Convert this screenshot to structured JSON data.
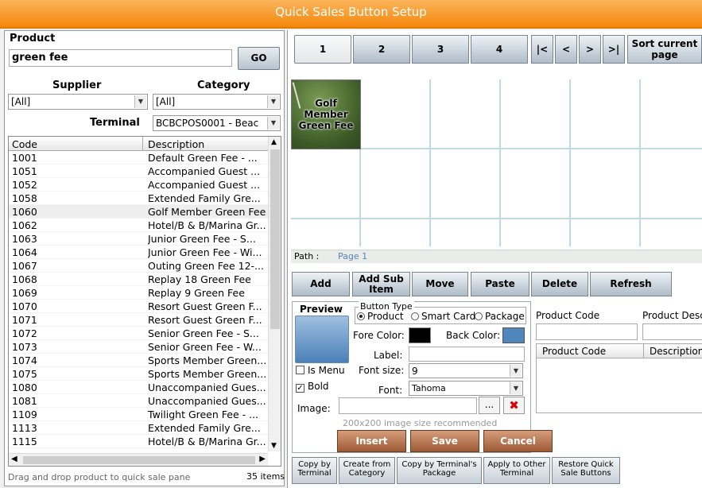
{
  "window": {
    "title": "Quick Sales Button Setup"
  },
  "left": {
    "product_label": "Product",
    "product_value": "green fee",
    "go_label": "GO",
    "supplier_label": "Supplier",
    "category_label": "Category",
    "supplier_value": "[All]",
    "category_value": "[All]",
    "terminal_label": "Terminal",
    "terminal_value": "BCBCPOS0001 - Beac",
    "columns": [
      "Code",
      "Description"
    ],
    "rows": [
      [
        "1001",
        "Default Green Fee - ..."
      ],
      [
        "1051",
        "Accompanied Guest ..."
      ],
      [
        "1052",
        "Accompanied Guest ..."
      ],
      [
        "1058",
        "Extended Family  Gre..."
      ],
      [
        "1060",
        "Golf Member Green Fee"
      ],
      [
        "1062",
        "Hotel/B & B/Marina Gr..."
      ],
      [
        "1063",
        "Junior Green Fee - S..."
      ],
      [
        "1064",
        "Junior Green Fee - Wi..."
      ],
      [
        "1067",
        "Outing Green Fee 12-..."
      ],
      [
        "1068",
        "Replay 18 Green Fee"
      ],
      [
        "1069",
        "Replay 9 Green Fee"
      ],
      [
        "1070",
        "Resort Guest Green F..."
      ],
      [
        "1071",
        "Resort Guest Green F..."
      ],
      [
        "1072",
        "Senior Green Fee - S..."
      ],
      [
        "1073",
        "Senior Green Fee - W..."
      ],
      [
        "1074",
        "Sports Member Green..."
      ],
      [
        "1075",
        "Sports Member Green..."
      ],
      [
        "1080",
        "Unaccompanied Gues..."
      ],
      [
        "1081",
        "Unaccompanied Gues..."
      ],
      [
        "1109",
        "Twilight Green Fee - ..."
      ],
      [
        "1113",
        "Extended Family  Gre..."
      ],
      [
        "1115",
        "Hotel/B & B/Marina Gr..."
      ]
    ],
    "footer_hint": "Drag and drop product to quick sale pane",
    "footer_count": "35 items"
  },
  "pages": {
    "tabs": [
      "1",
      "2",
      "3",
      "4"
    ],
    "first": "|<",
    "prev": "<",
    "next": ">",
    "last": ">|",
    "sort_label": "Sort current page"
  },
  "grid": {
    "button_label": "Golf Member Green Fee"
  },
  "path": {
    "label": "Path :",
    "value": "Page 1"
  },
  "actions": [
    "Add",
    "Add Sub Item",
    "Move",
    "Paste",
    "Delete",
    "Refresh"
  ],
  "editor": {
    "preview_label": "Preview",
    "button_type_label": "Button Type",
    "types": [
      "Product",
      "Smart Card",
      "Package"
    ],
    "fore_color_label": "Fore Color:",
    "back_color_label": "Back Color:",
    "label_label": "Label:",
    "font_size_label": "Font size:",
    "font_size_value": "9",
    "font_label": "Font:",
    "font_value": "Tahoma",
    "is_menu_label": "Is Menu",
    "bold_label": "Bold",
    "image_label": "Image:",
    "browse_label": "...",
    "image_hint": "200x200 image size recommended",
    "insert_label": "Insert",
    "save_label": "Save",
    "cancel_label": "Cancel",
    "product_code_label": "Product Code",
    "product_desc_label": "Product Desc",
    "list_cols": [
      "Product Code",
      "Description"
    ],
    "colors": {
      "fore": "#000000",
      "back": "#4f87bd"
    }
  },
  "bottom": [
    "Copy by Terminal",
    "Create from Category",
    "Copy by Terminal's Package",
    "Apply to Other Terminal",
    "Restore Quick Sale Buttons"
  ]
}
